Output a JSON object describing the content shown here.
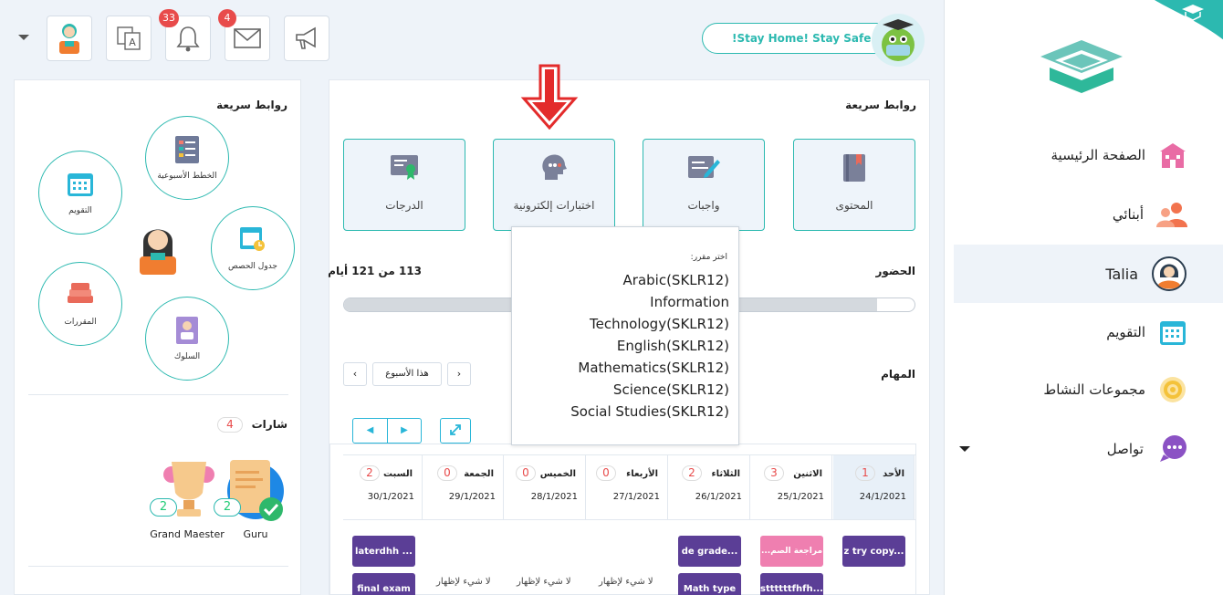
{
  "header": {
    "stay_home": "!Stay Home! Stay Safe",
    "notifications_count": "33",
    "messages_count": "4"
  },
  "sidebar": {
    "items": [
      {
        "label": "الصفحة الرئيسية",
        "icon": "school-building-icon",
        "color": "#e96ca5"
      },
      {
        "label": "أبنائي",
        "icon": "children-icon",
        "color": "#f2734e"
      },
      {
        "label": "Talia",
        "icon": "student-avatar-icon"
      },
      {
        "label": "التقويم",
        "icon": "calendar-icon",
        "color": "#29b6d8"
      },
      {
        "label": "مجموعات النشاط",
        "icon": "activity-target-icon",
        "color": "#f4c23a"
      },
      {
        "label": "تواصل",
        "icon": "chat-bubbles-icon",
        "color": "#8b52c4"
      }
    ]
  },
  "main": {
    "quick_links_title": "روابط سريعة",
    "tiles": [
      {
        "label": "المحتوى",
        "icon": "book-icon"
      },
      {
        "label": "واجبات",
        "icon": "homework-pen-icon"
      },
      {
        "label": "اختبارات إلكترونية",
        "icon": "quiz-head-icon"
      },
      {
        "label": "الدرجات",
        "icon": "certificate-icon"
      }
    ],
    "attendance_title": "الحضور",
    "attendance_value": "113 من 121 أيام",
    "attendance_fraction": 0.934,
    "tasks_title": "المهام",
    "this_week": "هذا الأسبوع",
    "days": [
      {
        "name": "الأحد",
        "count": "1",
        "date": "24/1/2021"
      },
      {
        "name": "الاثنين",
        "count": "3",
        "date": "25/1/2021"
      },
      {
        "name": "الثلاثاء",
        "count": "2",
        "date": "26/1/2021"
      },
      {
        "name": "الأربعاء",
        "count": "0",
        "date": "27/1/2021"
      },
      {
        "name": "الخميس",
        "count": "0",
        "date": "28/1/2021"
      },
      {
        "name": "الجمعة",
        "count": "0",
        "date": "29/1/2021"
      },
      {
        "name": "السبت",
        "count": "2",
        "date": "30/1/2021"
      }
    ],
    "tasks": {
      "sun_1": "z try copy...",
      "mon_1": "مراجعة الصم...",
      "mon_2": "sttttttfhfh...",
      "tue_1": "de grade...",
      "tue_2": "Math type",
      "sat_1": "laterdhh ...",
      "sat_2": "final exam",
      "nothing": "لا شيء لإظهار"
    },
    "task_colors": {
      "purple": "#5b3e96",
      "pink": "#ef7fb0"
    }
  },
  "popup": {
    "hint": "اختر مقرر:",
    "options": [
      "Arabic(SKLR12)",
      "Information",
      "Technology(SKLR12)",
      "English(SKLR12)",
      "Mathematics(SKLR12)",
      "Science(SKLR12)",
      "Social Studies(SKLR12)"
    ]
  },
  "left_panel": {
    "quick_links_title": "روابط سريعة",
    "circles": [
      {
        "label": "الخطط الأسبوعية",
        "icon": "weekly-plan-icon"
      },
      {
        "label": "التقويم",
        "icon": "calendar-icon"
      },
      {
        "label": "جدول الحصص",
        "icon": "schedule-icon"
      },
      {
        "label": "المقررات",
        "icon": "courses-books-icon"
      },
      {
        "label": "السلوك",
        "icon": "behavior-icon"
      }
    ],
    "badges_title": "شارات",
    "badges_count": "4",
    "badges": [
      {
        "name": "Guru",
        "count": "2"
      },
      {
        "name": "Grand Maester",
        "count": "2"
      }
    ]
  }
}
